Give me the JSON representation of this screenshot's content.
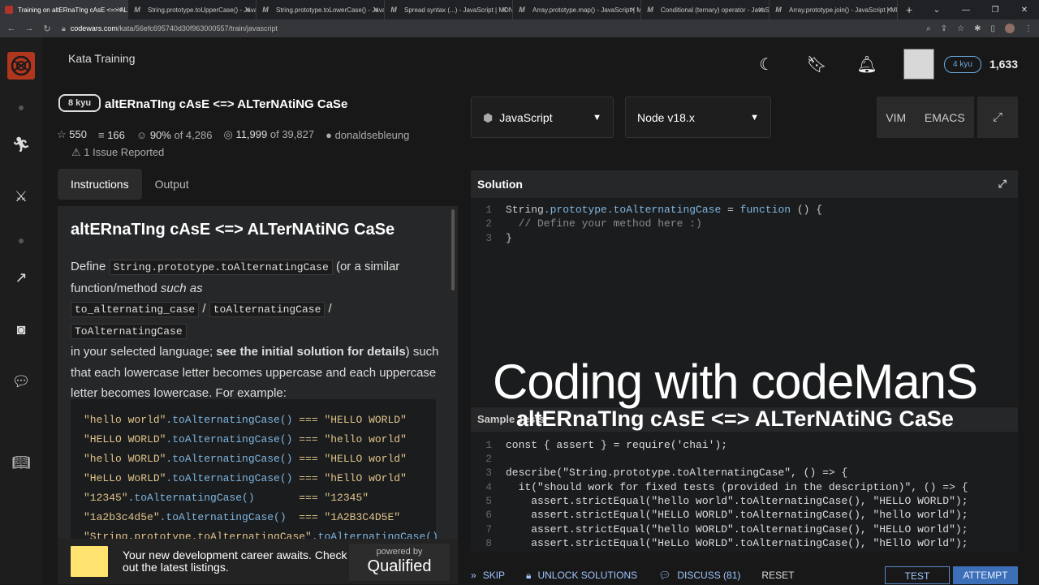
{
  "browser": {
    "tabs": [
      {
        "label": "Training on altERnaTIng cAsE <=> ALTerNAtiNG CaSe | Codewars",
        "active": true
      },
      {
        "label": "String.prototype.toUpperCase() - JavaScript | MDN"
      },
      {
        "label": "String.prototype.toLowerCase() - JavaScript | MDN"
      },
      {
        "label": "Spread syntax (...) - JavaScript | MDN"
      },
      {
        "label": "Array.prototype.map() - JavaScript | MDN"
      },
      {
        "label": "Conditional (ternary) operator - JavaScript | MDN"
      },
      {
        "label": "Array.prototype.join() - JavaScript | MDN"
      }
    ],
    "new_tab": "+",
    "url_host": "codewars.com",
    "url_path": "/kata/56efc695740d30f963000557/train/javascript"
  },
  "topbar": {
    "title": "Kata Training",
    "rank": "4 kyu",
    "honor": "1,633"
  },
  "kata": {
    "kyu": "8 kyu",
    "name": "altERnaTIng cAsE <=> ALTerNAtiNG CaSe",
    "stars": "550",
    "collections": "166",
    "satisfaction": "90%",
    "satisfaction_of": "of 4,286",
    "completed": "11,999",
    "completed_of": "of 39,827",
    "author": "donaldsebleung",
    "issues": "1 Issue Reported"
  },
  "panel_tabs": {
    "instructions": "Instructions",
    "output": "Output"
  },
  "instructions": {
    "heading": "altERnaTIng cAsE <=> ALTerNAtiNG CaSe",
    "p_define": "Define",
    "code_main": "String.prototype.toAlternatingCase",
    "p_or": "(or a similar function/method",
    "p_such_as": "such as",
    "code_a": "to_alternating_case",
    "code_b": "toAlternatingCase",
    "code_c": "ToAlternatingCase",
    "slash": "/",
    "p_lang": "in your selected language;",
    "p_bold": "see the initial solution for details",
    "p_rest": ") such that each lowercase letter becomes uppercase and each uppercase letter becomes lowercase. For example:",
    "examples": [
      {
        "lhs": "\"hello world\"",
        "method": ".toAlternatingCase()",
        "rhs": " === \"HELLO WORLD\""
      },
      {
        "lhs": "\"HELLO WORLD\"",
        "method": ".toAlternatingCase()",
        "rhs": " === \"hello world\""
      },
      {
        "lhs": "\"hello WORLD\"",
        "method": ".toAlternatingCase()",
        "rhs": " === \"HELLO world\""
      },
      {
        "lhs": "\"HeLLo WoRLD\"",
        "method": ".toAlternatingCase()",
        "rhs": " === \"hEllO wOrld\""
      },
      {
        "lhs": "\"12345\"",
        "method": ".toAlternatingCase()",
        "rhs": "       === \"12345\""
      },
      {
        "lhs": "\"1a2b3c4d5e\"",
        "method": ".toAlternatingCase()",
        "rhs": "  === \"1A2B3C4D5E\""
      },
      {
        "lhs": "\"String.prototype.toAlternatingCase\"",
        "method": ".toAlternatingCase()",
        "rhs": ""
      }
    ]
  },
  "ad": {
    "text": "Your new development career awaits. Check out the latest listings.",
    "powered": "powered by",
    "brand": "Qualified"
  },
  "editor_controls": {
    "language": "JavaScript",
    "version": "Node v18.x",
    "vim": "VIM",
    "emacs": "EMACS"
  },
  "solution": {
    "title": "Solution",
    "lines": [
      {
        "n": "1",
        "a": "String",
        "b": ".prototype.toAlternatingCase",
        "c": " = ",
        "d": "function",
        "e": " () {"
      },
      {
        "n": "2",
        "comment": "  // Define your method here :)"
      },
      {
        "n": "3",
        "text": "}"
      }
    ]
  },
  "overlay": {
    "line1": "Coding with codeManS",
    "line2": "altERnaTIng cAsE  <=> ALTerNAtiNG CaSe"
  },
  "sample_tests": {
    "title": "Sample Tests",
    "lines": [
      {
        "n": "1",
        "text": "const { assert } = require('chai');"
      },
      {
        "n": "2",
        "text": ""
      },
      {
        "n": "3",
        "text": "describe(\"String.prototype.toAlternatingCase\", () => {"
      },
      {
        "n": "4",
        "text": "  it(\"should work for fixed tests (provided in the description)\", () => {"
      },
      {
        "n": "5",
        "text": "    assert.strictEqual(\"hello world\".toAlternatingCase(), \"HELLO WORLD\");"
      },
      {
        "n": "6",
        "text": "    assert.strictEqual(\"HELLO WORLD\".toAlternatingCase(), \"hello world\");"
      },
      {
        "n": "7",
        "text": "    assert.strictEqual(\"hello WORLD\".toAlternatingCase(), \"HELLO world\");"
      },
      {
        "n": "8",
        "text": "    assert.strictEqual(\"HeLLo WoRLD\".toAlternatingCase(), \"hEllO wOrld\");"
      }
    ]
  },
  "bottom": {
    "skip": "SKIP",
    "unlock": "UNLOCK SOLUTIONS",
    "discuss": "DISCUSS (81)",
    "reset": "RESET",
    "test": "TEST",
    "attempt": "ATTEMPT"
  }
}
